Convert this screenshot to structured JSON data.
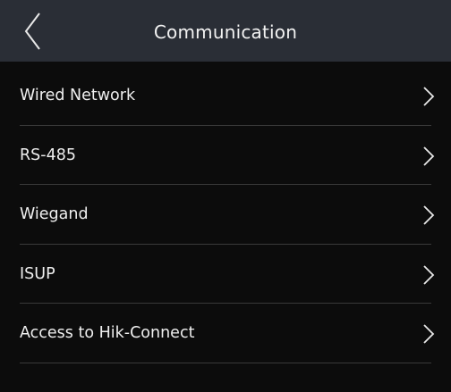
{
  "header": {
    "title": "Communication",
    "back_icon": "chevron-left-icon"
  },
  "menu": {
    "chevron_icon": "chevron-right-icon",
    "items": [
      {
        "label": "Wired Network"
      },
      {
        "label": "RS-485"
      },
      {
        "label": "Wiegand"
      },
      {
        "label": "ISUP"
      },
      {
        "label": "Access to Hik-Connect"
      }
    ]
  },
  "colors": {
    "header_bg": "#2a2e36",
    "page_bg": "#0c0c0c",
    "text": "#efefef",
    "divider": "#3a3a3a"
  }
}
